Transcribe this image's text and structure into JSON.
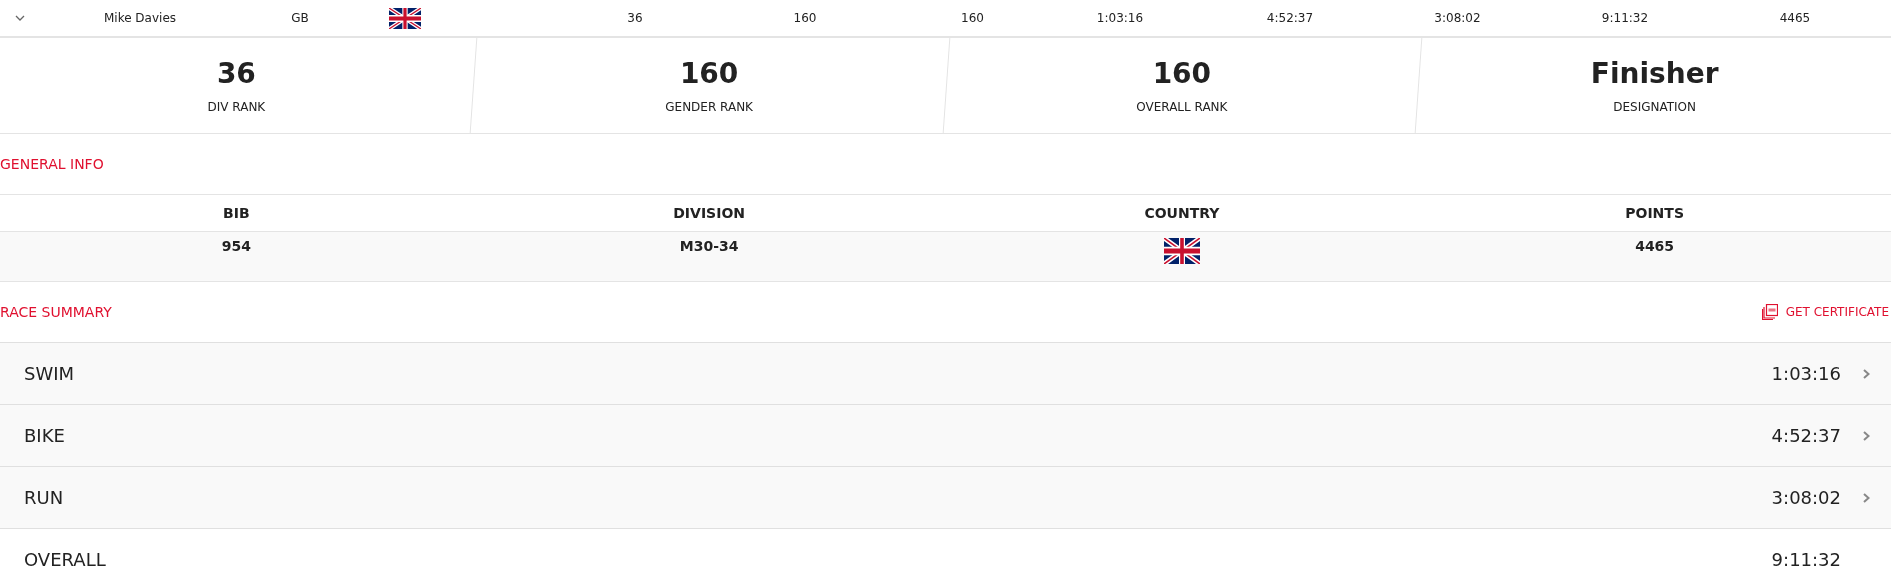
{
  "result_row": {
    "expanded": true,
    "name": "Mike Davies",
    "country_code": "GB",
    "cells": [
      "36",
      "160",
      "160",
      "1:03:16",
      "4:52:37",
      "3:08:02",
      "9:11:32",
      "4465"
    ]
  },
  "ranks": [
    {
      "value": "36",
      "label": "DIV RANK"
    },
    {
      "value": "160",
      "label": "GENDER RANK"
    },
    {
      "value": "160",
      "label": "OVERALL RANK"
    },
    {
      "value": "Finisher",
      "label": "DESIGNATION"
    }
  ],
  "general_info": {
    "title": "GENERAL INFO",
    "columns": [
      {
        "heading": "BIB",
        "value": "954",
        "kind": "text"
      },
      {
        "heading": "DIVISION",
        "value": "M30-34",
        "kind": "text"
      },
      {
        "heading": "COUNTRY",
        "kind": "flag"
      },
      {
        "heading": "POINTS",
        "value": "4465",
        "kind": "text"
      }
    ]
  },
  "race_summary": {
    "title": "RACE SUMMARY",
    "certificate_link": "GET CERTIFICATE",
    "rows": [
      {
        "label": "SWIM",
        "time": "1:03:16",
        "kind": "split"
      },
      {
        "label": "BIKE",
        "time": "4:52:37",
        "kind": "split"
      },
      {
        "label": "RUN",
        "time": "3:08:02",
        "kind": "split"
      },
      {
        "label": "OVERALL",
        "time": "9:11:32",
        "kind": "total"
      }
    ]
  }
}
